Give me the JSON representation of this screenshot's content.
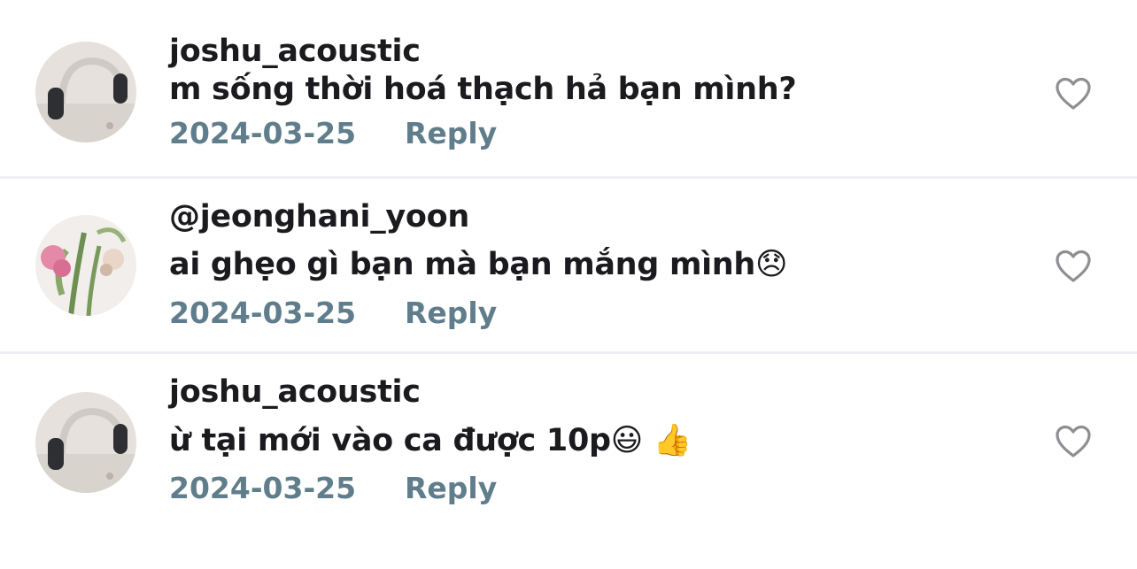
{
  "comments": [
    {
      "username": "joshu_acoustic",
      "text": "m sống thời hoá thạch hả bạn mình?",
      "date": "2024-03-25",
      "reply_label": "Reply"
    },
    {
      "username": "@jeonghani_yoon",
      "text": "ai ghẹo gì bạn mà bạn mắng mình😞",
      "date": "2024-03-25",
      "reply_label": "Reply"
    },
    {
      "username": "joshu_acoustic",
      "text": "ừ tại mới vào ca được 10p😃 👍",
      "date": "2024-03-25",
      "reply_label": "Reply"
    }
  ],
  "icons": {
    "like": "heart-outline-icon"
  },
  "colors": {
    "text": "#1b1b1f",
    "meta": "#607d8b",
    "icon": "#8e8e93",
    "divider": "#eef0f5"
  }
}
